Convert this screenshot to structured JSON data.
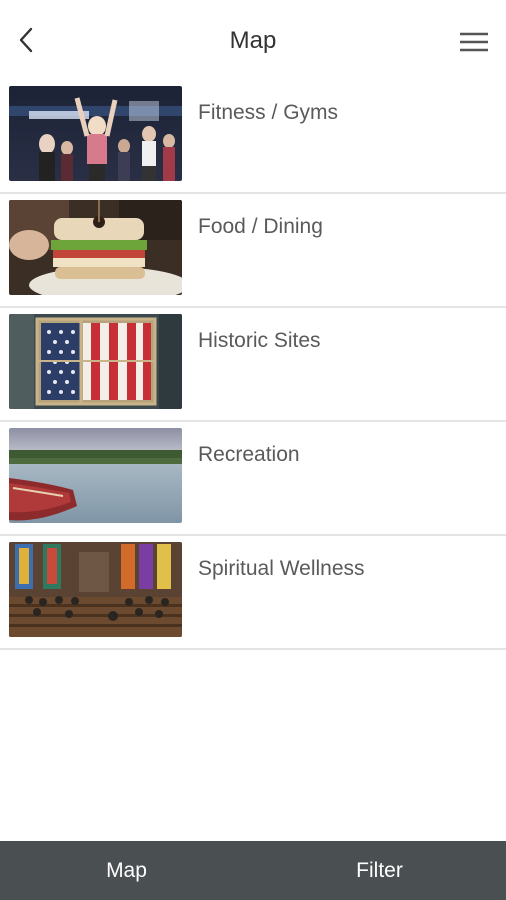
{
  "header": {
    "title": "Map",
    "back_icon": "chevron-left-icon",
    "menu_icon": "hamburger-menu-icon"
  },
  "categories": [
    {
      "label": "Fitness / Gyms",
      "image": "fitness-gym-photo"
    },
    {
      "label": "Food / Dining",
      "image": "sandwich-photo"
    },
    {
      "label": "Historic Sites",
      "image": "american-flag-photo"
    },
    {
      "label": "Recreation",
      "image": "canoe-lake-photo"
    },
    {
      "label": "Spiritual Wellness",
      "image": "church-interior-photo"
    }
  ],
  "bottom_nav": {
    "map_label": "Map",
    "filter_label": "Filter",
    "background": "#4a4f52"
  }
}
